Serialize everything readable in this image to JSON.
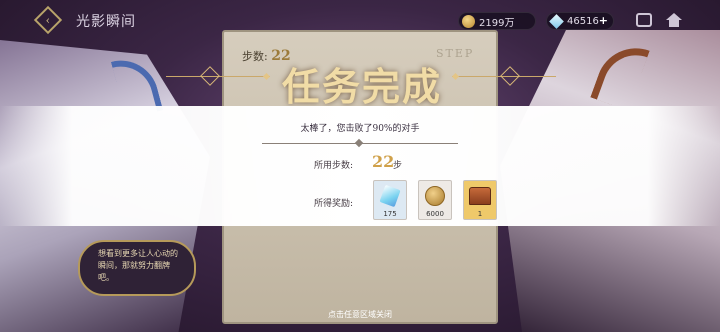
{
  "topbar": {
    "title": "光影瞬间",
    "gold": "2199万",
    "gems": "46516",
    "add_symbol": "+"
  },
  "board": {
    "steps_label": "步数:",
    "steps_value": "22",
    "step_word": "STEP"
  },
  "result": {
    "title": "任务完成",
    "subtitle": "太棒了，您击败了90%的对手",
    "steps_label": "所用步数:",
    "steps_value": "22",
    "steps_unit": "步",
    "reward_label": "所得奖励:",
    "rewards": [
      {
        "icon": "crystal-icon",
        "count": "175"
      },
      {
        "icon": "coin-icon",
        "count": "6000"
      },
      {
        "icon": "chest-icon",
        "count": "1"
      }
    ]
  },
  "speech": "想看到更多让人心动的瞬间，那就努力翻牌吧。",
  "close_hint": "点击任意区域关闭",
  "colors": {
    "title_gold": "#f1dca6",
    "steps_accent": "#d0a14a",
    "background": "#3b2645"
  }
}
